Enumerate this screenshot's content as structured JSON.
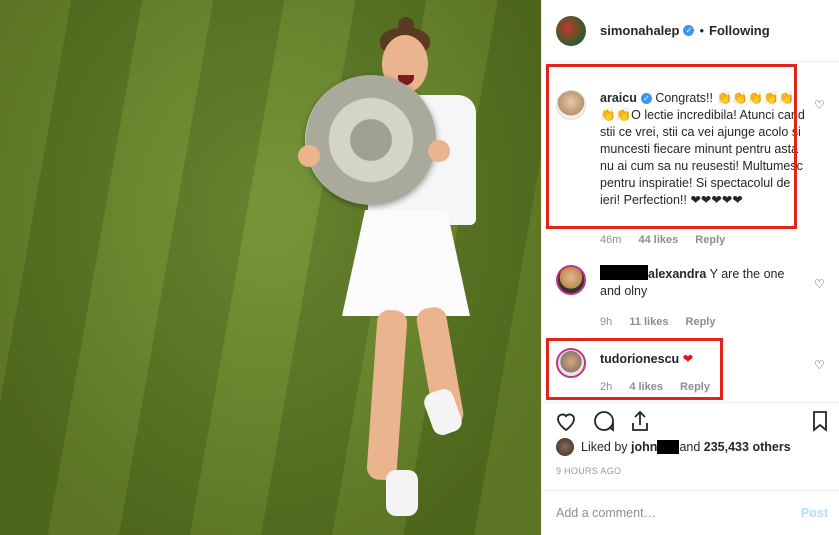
{
  "post": {
    "username": "simonahalep",
    "follow_status": "Following"
  },
  "comments": [
    {
      "user": "araicu",
      "text": "Congrats!! 👏👏👏👏👏👏👏O lectie incredibila! Atunci cand stii ce vrei, stii ca vei ajunge acolo si muncesti fiecare minunt pentru asta nu ai cum sa nu reusesti! Multumesc pentru inspiratie! Si spectacolul de ieri! Perfection!! ❤❤❤❤❤",
      "time": "46m",
      "likes": "44 likes",
      "reply": "Reply"
    },
    {
      "user": "alexandra",
      "text": " Y are the one and olny",
      "time": "9h",
      "likes": "11 likes",
      "reply": "Reply"
    },
    {
      "user": "tudorionescu",
      "text": "❤",
      "time": "2h",
      "likes": "4 likes",
      "reply": "Reply"
    }
  ],
  "likes_summary": {
    "prefix": "Liked by ",
    "user": "john",
    "middle": " and ",
    "count": "235,433 others"
  },
  "timestamp": "9 HOURS AGO",
  "add_comment_placeholder": "Add a comment…",
  "post_button": "Post",
  "colors": {
    "highlight_box": "#e2231a",
    "verified": "#3897f0",
    "heart": "#e0121b",
    "post_disabled": "#b2dffc"
  },
  "icons": [
    "verified-badge-icon",
    "heart-outline-icon",
    "comment-icon",
    "share-icon",
    "bookmark-icon"
  ]
}
